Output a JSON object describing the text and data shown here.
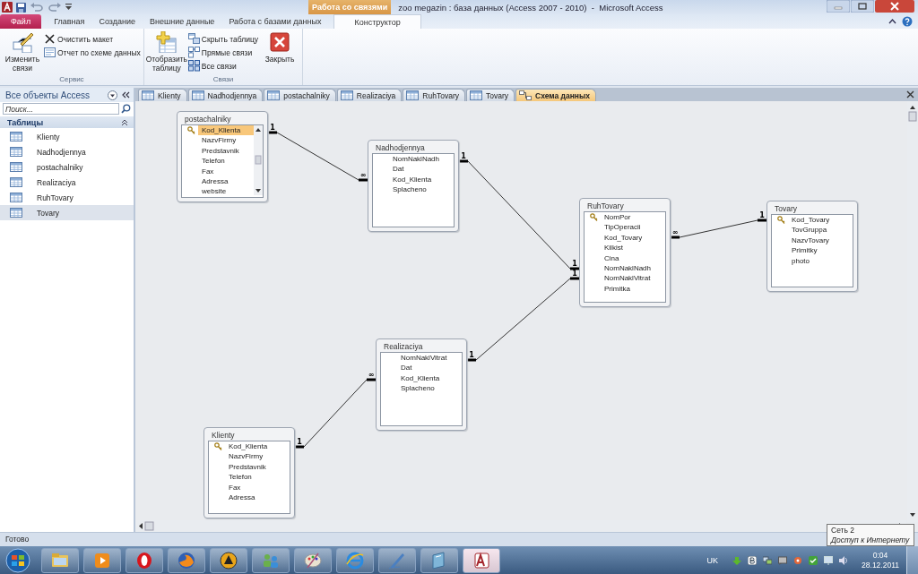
{
  "title_bar": {
    "context_tab": "Работа со связями",
    "title": "zoo megazin : база данных (Access 2007 - 2010)  -  Microsoft Access"
  },
  "ribbon_tabs": [
    {
      "label": "Файл",
      "kind": "file",
      "selected": false
    },
    {
      "label": "Главная",
      "kind": "normal",
      "selected": false
    },
    {
      "label": "Создание",
      "kind": "normal",
      "selected": false
    },
    {
      "label": "Внешние данные",
      "kind": "normal",
      "selected": false
    },
    {
      "label": "Работа с базами данных",
      "kind": "normal",
      "selected": false
    },
    {
      "label": "Конструктор",
      "kind": "normal",
      "selected": true
    }
  ],
  "ribbon_groups": [
    {
      "label": "Сервис",
      "commands": [
        {
          "label": "Изменить связи",
          "kind": "large"
        },
        {
          "label": "Очистить макет",
          "kind": "small"
        },
        {
          "label": "Отчет по схеме данных",
          "kind": "small"
        }
      ]
    },
    {
      "label": "Связи",
      "commands": [
        {
          "label": "Отобразить таблицу",
          "kind": "large"
        },
        {
          "label": "Скрыть таблицу",
          "kind": "small"
        },
        {
          "label": "Прямые связи",
          "kind": "small"
        },
        {
          "label": "Все связи",
          "kind": "small"
        },
        {
          "label": "Закрыть",
          "kind": "large"
        }
      ]
    }
  ],
  "nav_pane": {
    "title": "Все объекты Access",
    "search": {
      "placeholder": "Поиск..."
    },
    "section": "Таблицы",
    "items": [
      {
        "label": "Klienty",
        "selected": false
      },
      {
        "label": "Nadhodjennya",
        "selected": false
      },
      {
        "label": "postachalniky",
        "selected": false
      },
      {
        "label": "Realizaciya",
        "selected": false
      },
      {
        "label": "RuhTovary",
        "selected": false
      },
      {
        "label": "Tovary",
        "selected": true
      }
    ]
  },
  "doc_tabs": [
    {
      "label": "Klienty",
      "kind": "table",
      "selected": false
    },
    {
      "label": "Nadhodjennya",
      "kind": "table",
      "selected": false
    },
    {
      "label": "postachalniky",
      "kind": "table",
      "selected": false
    },
    {
      "label": "Realizaciya",
      "kind": "table",
      "selected": false
    },
    {
      "label": "RuhTovary",
      "kind": "table",
      "selected": false
    },
    {
      "label": "Tovary",
      "kind": "table",
      "selected": false
    },
    {
      "label": "Схема данных",
      "kind": "diagram",
      "selected": true
    }
  ],
  "diagram": {
    "tables": [
      {
        "name": "postachalniky",
        "kind": "scrolling",
        "fields": [
          {
            "name": "Kod_Klienta",
            "key": true,
            "selected": true
          },
          {
            "name": "NazvFirmy",
            "key": false,
            "selected": false
          },
          {
            "name": "Predstavnik",
            "key": false,
            "selected": false
          },
          {
            "name": "Telefon",
            "key": false,
            "selected": false
          },
          {
            "name": "Fax",
            "key": false,
            "selected": false
          },
          {
            "name": "Adressa",
            "key": false,
            "selected": false
          },
          {
            "name": "website",
            "key": false,
            "selected": false
          }
        ]
      },
      {
        "name": "Nadhodjennya",
        "kind": "plain",
        "fields": [
          {
            "name": "NomNaklNadh",
            "key": false,
            "selected": false
          },
          {
            "name": "Dat",
            "key": false,
            "selected": false
          },
          {
            "name": "Kod_Klienta",
            "key": false,
            "selected": false
          },
          {
            "name": "Splacheno",
            "key": false,
            "selected": false
          }
        ]
      },
      {
        "name": "RuhTovary",
        "kind": "plain",
        "fields": [
          {
            "name": "NomPor",
            "key": true,
            "selected": false
          },
          {
            "name": "TipOperacii",
            "key": false,
            "selected": false
          },
          {
            "name": "Kod_Tovary",
            "key": false,
            "selected": false
          },
          {
            "name": "Kilkist",
            "key": false,
            "selected": false
          },
          {
            "name": "Cina",
            "key": false,
            "selected": false
          },
          {
            "name": "NomNaklNadh",
            "key": false,
            "selected": false
          },
          {
            "name": "NomNaklVitrat",
            "key": false,
            "selected": false
          },
          {
            "name": "Primitka",
            "key": false,
            "selected": false
          }
        ]
      },
      {
        "name": "Tovary",
        "kind": "plain",
        "fields": [
          {
            "name": "Kod_Tovary",
            "key": true,
            "selected": false
          },
          {
            "name": "TovGruppa",
            "key": false,
            "selected": false
          },
          {
            "name": "NazvTovary",
            "key": false,
            "selected": false
          },
          {
            "name": "Primitky",
            "key": false,
            "selected": false
          },
          {
            "name": "photo",
            "key": false,
            "selected": false
          }
        ]
      },
      {
        "name": "Realizaciya",
        "kind": "plain",
        "fields": [
          {
            "name": "NomNaklVitrat",
            "key": false,
            "selected": false
          },
          {
            "name": "Dat",
            "key": false,
            "selected": false
          },
          {
            "name": "Kod_Klienta",
            "key": false,
            "selected": false
          },
          {
            "name": "Splacheno",
            "key": false,
            "selected": false
          }
        ]
      },
      {
        "name": "Klienty",
        "kind": "plain",
        "fields": [
          {
            "name": "Kod_Klienta",
            "key": true,
            "selected": false
          },
          {
            "name": "NazvFirmy",
            "key": false,
            "selected": false
          },
          {
            "name": "Predstavnik",
            "key": false,
            "selected": false
          },
          {
            "name": "Telefon",
            "key": false,
            "selected": false
          },
          {
            "name": "Fax",
            "key": false,
            "selected": false
          },
          {
            "name": "Adressa",
            "key": false,
            "selected": false
          }
        ]
      }
    ],
    "relationships": [
      {
        "start_mark": "1",
        "end_mark": "∞"
      },
      {
        "start_mark": "1",
        "end_mark": "1"
      },
      {
        "start_mark": "∞",
        "end_mark": "1"
      },
      {
        "start_mark": "1",
        "end_mark": "1"
      },
      {
        "start_mark": "1",
        "end_mark": "∞"
      }
    ]
  },
  "status_bar": {
    "text": "Готово"
  },
  "tooltip": {
    "title": "Сеть 2",
    "text": "Доступ к Интернету"
  },
  "taskbar": {
    "language": "UK",
    "time": "0:04",
    "date": "28.12.2011"
  }
}
